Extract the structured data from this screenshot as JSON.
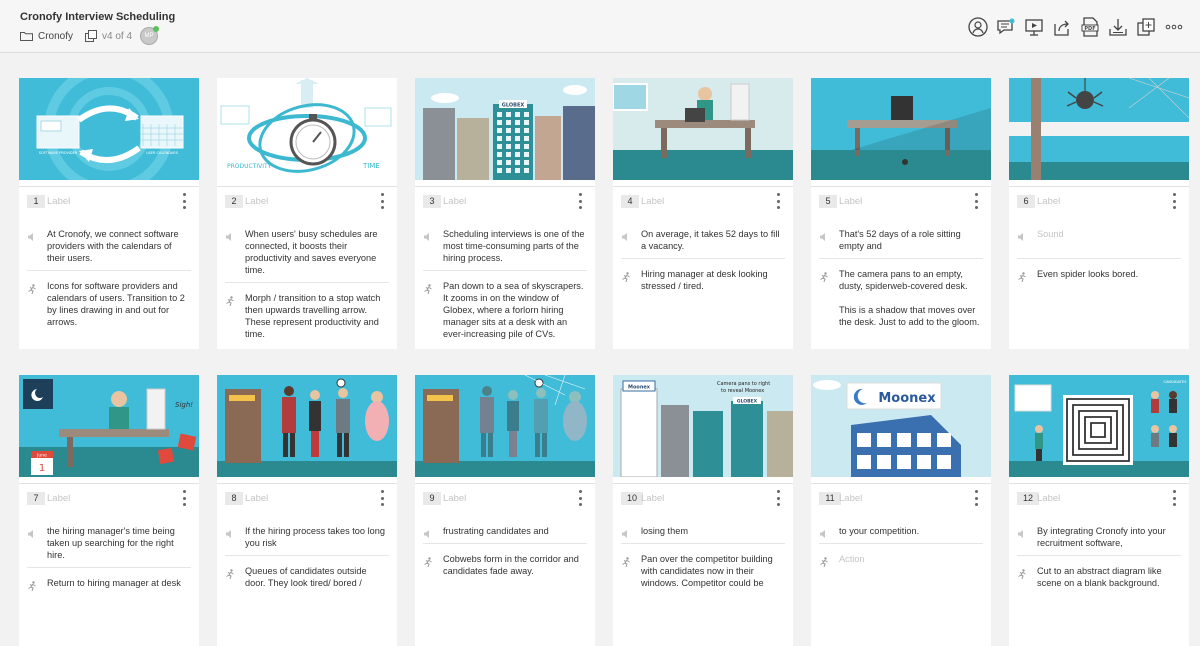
{
  "header": {
    "title": "Cronofy Interview Scheduling",
    "folder": "Cronofy",
    "version": "v4 of 4",
    "avatar": "MP"
  },
  "toolbar": [
    "user-icon",
    "comments-icon",
    "present-icon",
    "share-icon",
    "pdf-icon",
    "download-icon",
    "duplicate-icon",
    "more-icon"
  ],
  "frames": [
    {
      "num": "1",
      "label": "Label",
      "sound": "At Cronofy, we connect software providers with the calendars of their users.",
      "action": "Icons for software providers and calendars of users. Transition to 2 by lines drawing in and out for arrows.",
      "thumb": {
        "app": "SOFTWARE PROVIDER",
        "cal": "USER CALENDARS"
      }
    },
    {
      "num": "2",
      "label": "Label",
      "sound": "When users' busy schedules are connected, it boosts their productivity and saves everyone time.",
      "action": "Morph / transition to a stop watch then upwards travelling arrow. These represent productivity and time.",
      "thumb": {
        "left": "PRODUCTIVITY",
        "right": "TIME"
      }
    },
    {
      "num": "3",
      "label": "Label",
      "sound": "Scheduling interviews is one of the most time-consuming parts of the hiring process.",
      "action": "Pan down to a sea of skyscrapers. It zooms in on the window of Globex, where a forlorn hiring manager sits at a desk with an ever-increasing pile of CVs.",
      "thumb": {
        "sign": "GLOBEX"
      }
    },
    {
      "num": "4",
      "label": "Label",
      "sound": "On average, it takes 52 days to fill a vacancy.",
      "action": "Hiring manager at desk looking stressed / tired.",
      "thumb": {}
    },
    {
      "num": "5",
      "label": "Label",
      "sound": "That's 52 days of a role sitting empty and",
      "action": "The camera pans to an empty, dusty, spiderweb-covered desk.\n\nThis is a shadow that moves over the desk. Just to add to the gloom.",
      "thumb": {}
    },
    {
      "num": "6",
      "label": "Label",
      "sound": "Sound",
      "sound_placeholder": true,
      "action": "Even spider looks bored.",
      "thumb": {}
    },
    {
      "num": "7",
      "label": "Label",
      "sound": "the hiring manager's time being taken up searching for the right hire.",
      "action": "Return to hiring manager at desk",
      "thumb": {
        "month": "June",
        "day": "1",
        "sigh": "Sigh!"
      }
    },
    {
      "num": "8",
      "label": "Label",
      "sound": "If the hiring process takes too long you risk",
      "action": "Queues of candidates outside door. They look tired/ bored /",
      "thumb": {}
    },
    {
      "num": "9",
      "label": "Label",
      "sound": "frustrating candidates and",
      "action": "Cobwebs form in the corridor and candidates fade away.",
      "thumb": {}
    },
    {
      "num": "10",
      "label": "Label",
      "sound": "losing them",
      "action": "Pan over the competitor building with candidates now in their windows. Competitor could be",
      "thumb": {
        "caption": "Camera pans to right\nto reveal Moonex",
        "sign": "Moonex",
        "sign2": "GLOBEX"
      }
    },
    {
      "num": "11",
      "label": "Label",
      "sound": "to your competition.",
      "action": "Action",
      "action_placeholder": true,
      "thumb": {
        "sign": "Moonex"
      }
    },
    {
      "num": "12",
      "label": "Label",
      "sound": "By integrating Cronofy into your recruitment software,",
      "action": "Cut to an abstract diagram like scene on a blank background.",
      "thumb": {
        "caption": "CANDIDATES"
      }
    }
  ],
  "colors": {
    "sky": "#40bcd8",
    "teal": "#2a8a8f",
    "bg": "#f2f2f2"
  }
}
